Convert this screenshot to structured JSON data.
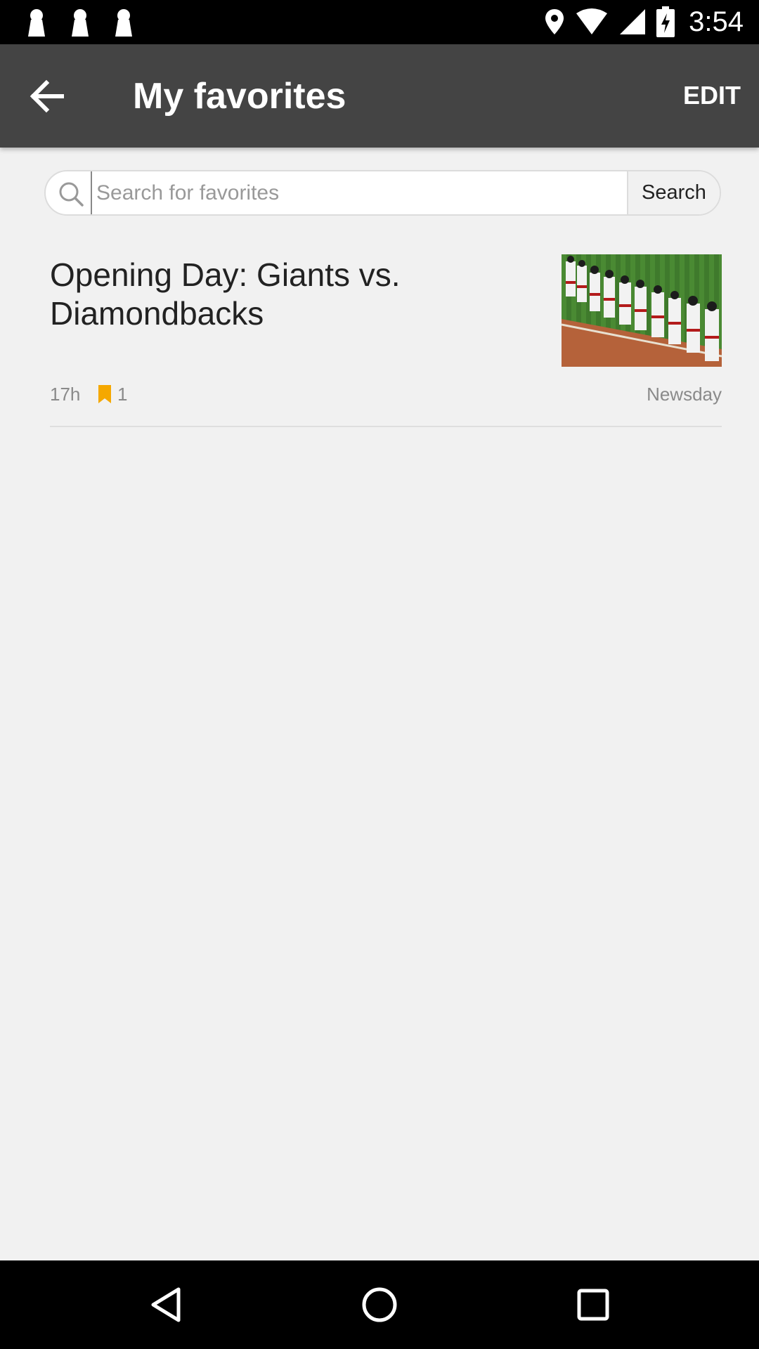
{
  "status_bar": {
    "time": "3:54",
    "icons": [
      "keyhole-icon",
      "keyhole-icon",
      "keyhole-icon",
      "location-icon",
      "wifi-icon",
      "signal-icon",
      "battery-charging-icon"
    ]
  },
  "app_bar": {
    "title": "My favorites",
    "edit_label": "EDIT",
    "back_icon": "arrow-back-icon",
    "background": "#444444"
  },
  "search": {
    "placeholder": "Search for favorites",
    "value": "",
    "button_label": "Search"
  },
  "articles": [
    {
      "title": "Opening Day: Giants vs. Diamondbacks",
      "time": "17h",
      "bookmark_count": "1",
      "source": "Newsday",
      "bookmark_color": "#f5a800"
    }
  ],
  "nav_bar": {
    "icons": [
      "back-triangle-icon",
      "home-circle-icon",
      "recents-square-icon"
    ]
  }
}
